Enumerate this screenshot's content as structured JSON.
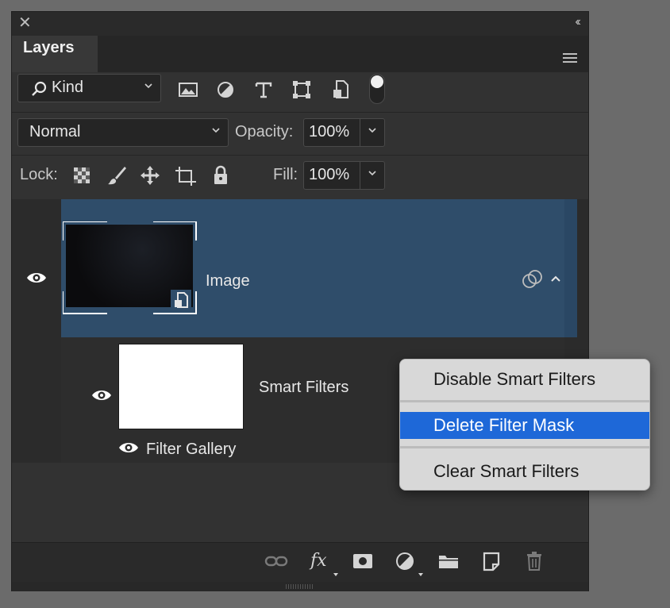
{
  "panel": {
    "tab_label": "Layers",
    "close_glyph": "✕",
    "collapse_glyph": "‹‹"
  },
  "filter_row": {
    "kind_label": "Kind",
    "tools": [
      "image-filter-icon",
      "adjustment-filter-icon",
      "type-filter-icon",
      "shape-filter-icon",
      "smart-object-filter-icon",
      "filter-toggle"
    ]
  },
  "blend_row": {
    "blend_mode": "Normal",
    "opacity_label": "Opacity:",
    "opacity_value": "100%"
  },
  "lock_row": {
    "lock_label": "Lock:",
    "fill_label": "Fill:",
    "fill_value": "100%"
  },
  "layers": {
    "image_layer_name": "Image",
    "smart_filters_label": "Smart Filters",
    "filter_gallery_label": "Filter Gallery"
  },
  "bottom_icons": [
    "link-icon",
    "fx-icon",
    "mask-icon",
    "adjustment-icon",
    "folder-icon",
    "new-layer-icon",
    "trash-icon"
  ],
  "bottom_fx_label": "fx",
  "context_menu": {
    "items": [
      "Disable Smart Filters",
      "Delete Filter Mask",
      "Clear Smart Filters"
    ],
    "highlighted": "Delete Filter Mask"
  },
  "colors": {
    "panel_bg": "#323232",
    "selected_layer": "#2f4d6a",
    "menu_highlight": "#1e68d8"
  }
}
